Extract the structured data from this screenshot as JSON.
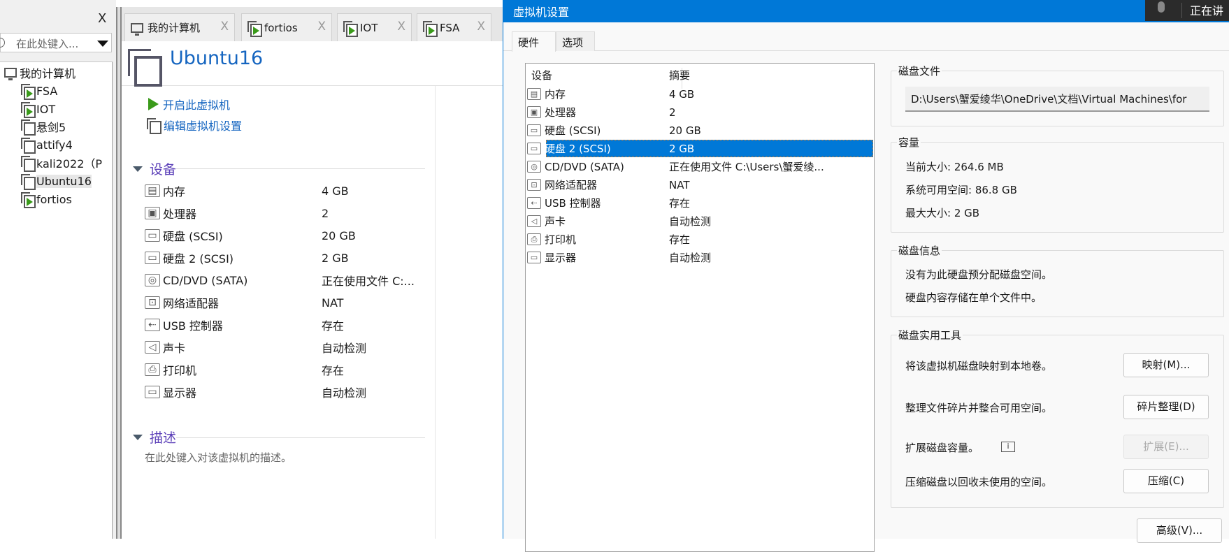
{
  "library": {
    "close": "X",
    "search_placeholder": "在此处键入...",
    "tree": [
      {
        "label": "我的计算机",
        "icon": "computer-icon"
      },
      {
        "label": "FSA",
        "icon": "vm-running-icon"
      },
      {
        "label": "IOT",
        "icon": "vm-running-icon"
      },
      {
        "label": "悬剑5",
        "icon": "vm-icon"
      },
      {
        "label": "attify4",
        "icon": "vm-icon"
      },
      {
        "label": "kali2022（P",
        "icon": "vm-icon"
      },
      {
        "label": "Ubuntu16",
        "icon": "vm-icon",
        "selected": true
      },
      {
        "label": "fortios",
        "icon": "vm-running-icon"
      }
    ]
  },
  "tabs": [
    {
      "label": "我的计算机",
      "close": "X"
    },
    {
      "label": "fortios",
      "close": "X"
    },
    {
      "label": "IOT",
      "close": "X"
    },
    {
      "label": "FSA",
      "close": "X"
    }
  ],
  "vm": {
    "title": "Ubuntu16",
    "actions": {
      "power_on": "开启此虚拟机",
      "edit": "编辑虚拟机设置"
    },
    "devices_header": "设备",
    "devices": [
      {
        "name": "内存",
        "value": "4 GB",
        "icon": "memory-icon"
      },
      {
        "name": "处理器",
        "value": "2",
        "icon": "cpu-icon"
      },
      {
        "name": "硬盘 (SCSI)",
        "value": "20 GB",
        "icon": "disk-icon"
      },
      {
        "name": "硬盘 2 (SCSI)",
        "value": "2 GB",
        "icon": "disk-icon"
      },
      {
        "name": "CD/DVD (SATA)",
        "value": "正在使用文件 C:...",
        "icon": "cd-icon"
      },
      {
        "name": "网络适配器",
        "value": "NAT",
        "icon": "network-icon"
      },
      {
        "name": "USB 控制器",
        "value": "存在",
        "icon": "usb-icon"
      },
      {
        "name": "声卡",
        "value": "自动检测",
        "icon": "sound-icon"
      },
      {
        "name": "打印机",
        "value": "存在",
        "icon": "printer-icon"
      },
      {
        "name": "显示器",
        "value": "自动检测",
        "icon": "display-icon"
      }
    ],
    "description_header": "描述",
    "description_placeholder": "在此处键入对该虚拟机的描述。"
  },
  "dialog": {
    "title": "虚拟机设置",
    "speaking": "正在讲",
    "tabs": [
      "硬件",
      "选项"
    ],
    "list_headers": [
      "设备",
      "摘要"
    ],
    "devices": [
      {
        "name": "内存",
        "summary": "4 GB"
      },
      {
        "name": "处理器",
        "summary": "2"
      },
      {
        "name": "硬盘 (SCSI)",
        "summary": "20 GB"
      },
      {
        "name": "硬盘 2 (SCSI)",
        "summary": "2 GB",
        "selected": true
      },
      {
        "name": "CD/DVD (SATA)",
        "summary": "正在使用文件 C:\\Users\\蟹爱绫..."
      },
      {
        "name": "网络适配器",
        "summary": "NAT"
      },
      {
        "name": "USB 控制器",
        "summary": "存在"
      },
      {
        "name": "声卡",
        "summary": "自动检测"
      },
      {
        "name": "打印机",
        "summary": "存在"
      },
      {
        "name": "显示器",
        "summary": "自动检测"
      }
    ],
    "disk_file": {
      "label": "磁盘文件",
      "path": "D:\\Users\\蟹爱绫华\\OneDrive\\文档\\Virtual Machines\\for"
    },
    "capacity": {
      "label": "容量",
      "current": "当前大小: 264.6 MB",
      "available": "系统可用空间: 86.8 GB",
      "max": "最大大小: 2 GB"
    },
    "disk_info": {
      "label": "磁盘信息",
      "line1": "没有为此硬盘预分配磁盘空间。",
      "line2": "硬盘内容存储在单个文件中。"
    },
    "utilities": {
      "label": "磁盘实用工具",
      "map_text": "将该虚拟机磁盘映射到本地卷。",
      "map_btn": "映射(M)...",
      "defrag_text": "整理文件碎片并整合可用空间。",
      "defrag_btn": "碎片整理(D)",
      "expand_text": "扩展磁盘容量。",
      "expand_btn": "扩展(E)...",
      "compact_text": "压缩磁盘以回收未使用的空间。",
      "compact_btn": "压缩(C)"
    },
    "advanced_btn": "高级(V)...",
    "accent": "#0078d7"
  }
}
